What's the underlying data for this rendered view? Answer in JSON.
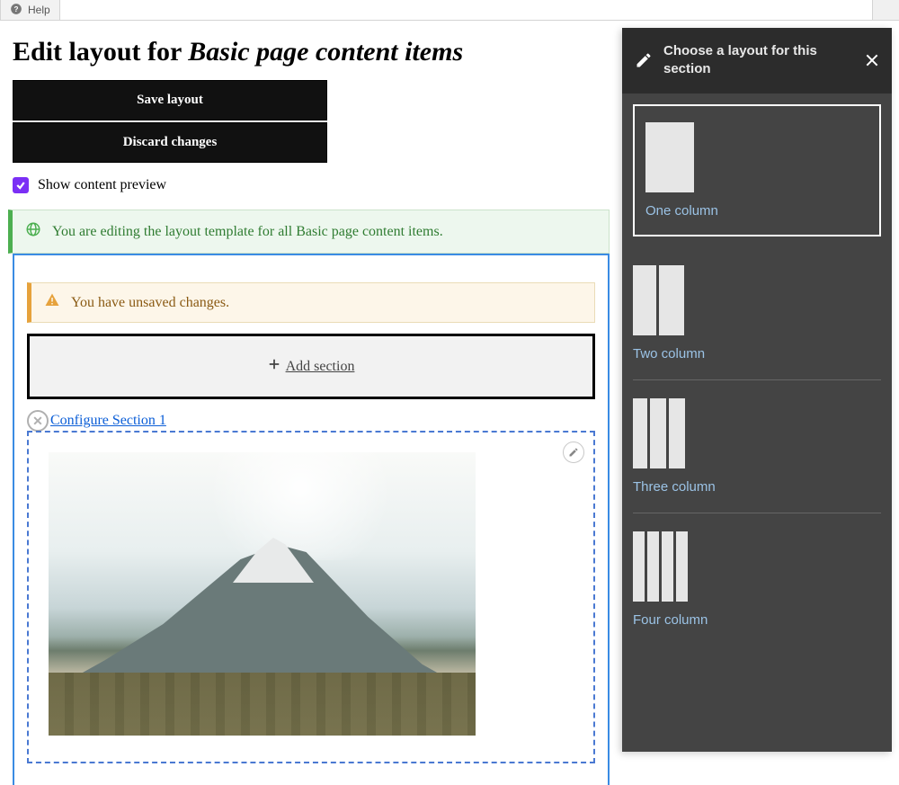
{
  "topbar": {
    "help_label": "Help"
  },
  "heading": {
    "prefix": "Edit layout for ",
    "italic": "Basic page content items"
  },
  "actions": {
    "save": "Save layout",
    "discard": "Discard changes"
  },
  "preview": {
    "label": "Show content preview",
    "checked": true
  },
  "status": {
    "text": "You are editing the layout template for all Basic page content items."
  },
  "warning": {
    "text": "You have unsaved changes."
  },
  "add_section": {
    "label": "Add section"
  },
  "section": {
    "configure_link": "Configure Section 1"
  },
  "panel": {
    "title": "Choose a layout for this section",
    "options": [
      {
        "label": "One column",
        "cols": 1,
        "selected": true
      },
      {
        "label": "Two column",
        "cols": 2,
        "selected": false
      },
      {
        "label": "Three column",
        "cols": 3,
        "selected": false
      },
      {
        "label": "Four column",
        "cols": 4,
        "selected": false
      }
    ]
  }
}
